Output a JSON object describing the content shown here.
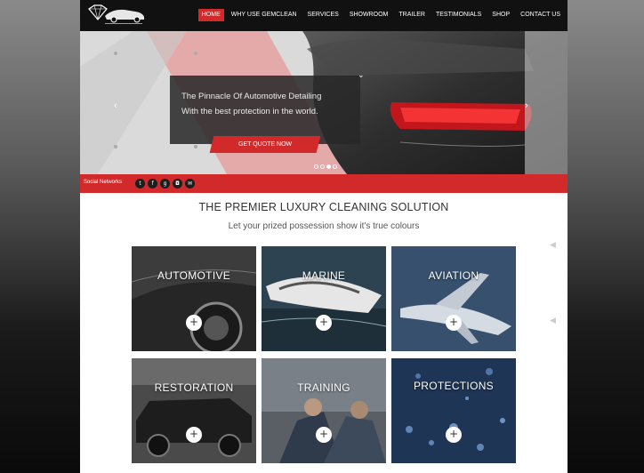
{
  "header": {
    "nav": [
      {
        "label": "HOME",
        "active": true
      },
      {
        "label": "WHY USE GEMCLEAN",
        "active": false
      },
      {
        "label": "SERVICES",
        "active": false
      },
      {
        "label": "SHOWROOM",
        "active": false
      },
      {
        "label": "TRAILER",
        "active": false
      },
      {
        "label": "TESTIMONIALS",
        "active": false
      },
      {
        "label": "SHOP",
        "active": false
      },
      {
        "label": "CONTACT US",
        "active": false
      }
    ]
  },
  "hero": {
    "line1": "The Pinnacle Of Automotive Detailing",
    "line2": "With the best protection in the world.",
    "cta": "GET QUOTE NOW",
    "slides_total": 4,
    "slide_active": 3
  },
  "social": {
    "label": "Social Networks",
    "icons": [
      {
        "name": "twitter-icon",
        "glyph": "t"
      },
      {
        "name": "facebook-icon",
        "glyph": "f"
      },
      {
        "name": "google-plus-icon",
        "glyph": "g"
      },
      {
        "name": "instagram-icon",
        "glyph": "◘"
      },
      {
        "name": "email-icon",
        "glyph": "✉"
      }
    ]
  },
  "main": {
    "title": "THE PREMIER LUXURY CLEANING SOLUTION",
    "subtitle": "Let your prized possession show it's true colours",
    "tiles": [
      {
        "label": "AUTOMOTIVE",
        "plus": "+"
      },
      {
        "label": "MARINE",
        "plus": "+"
      },
      {
        "label": "AVIATION",
        "plus": "+"
      },
      {
        "label": "RESTORATION",
        "plus": "+"
      },
      {
        "label": "TRAINING",
        "plus": "+"
      },
      {
        "label": "PROTECTIONS",
        "plus": "+"
      }
    ]
  },
  "colors": {
    "accent": "#d22a2a",
    "header_bg": "#111111"
  }
}
